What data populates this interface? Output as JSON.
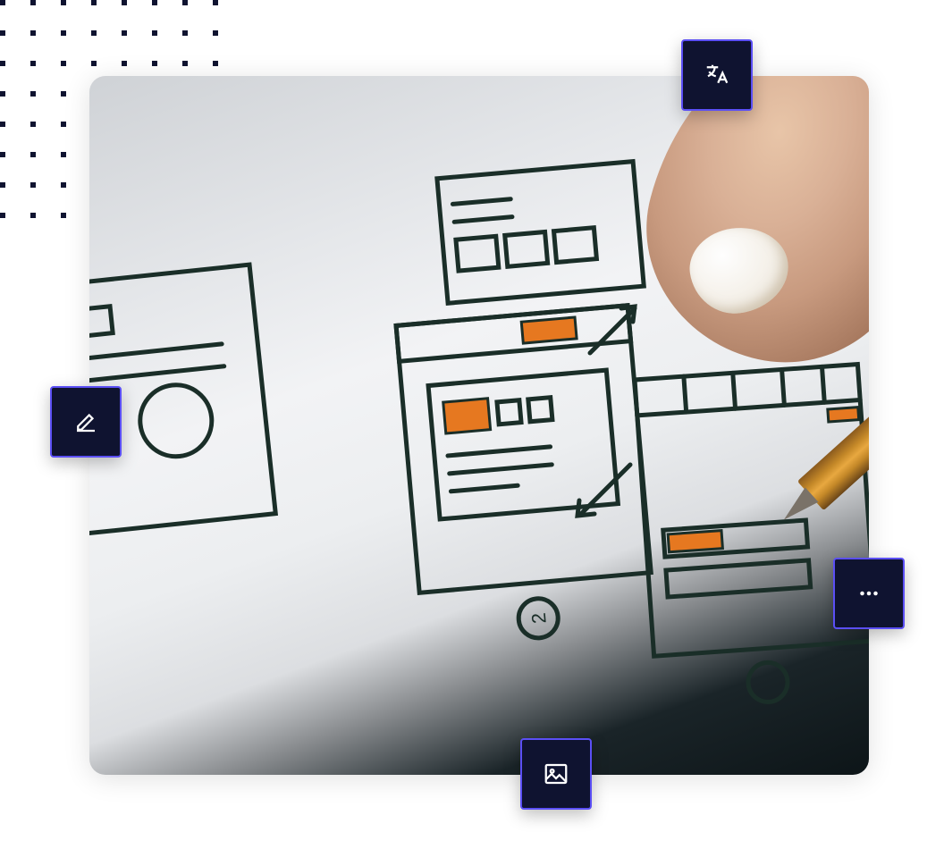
{
  "icons": {
    "translate": "translate-icon",
    "edit": "edit-icon",
    "more": "more-icon",
    "image": "image-icon"
  },
  "colors": {
    "tile_bg": "#0f1330",
    "tile_border": "#5b4ff5",
    "icon_stroke": "#ffffff",
    "dot": "#0f1330",
    "accent_orange": "#e67820"
  }
}
